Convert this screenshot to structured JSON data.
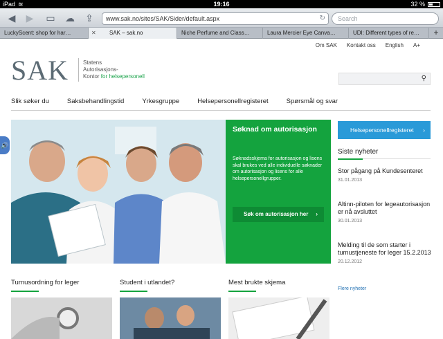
{
  "status": {
    "time": "19:16",
    "battery": "32 %",
    "battery_level": 0.32
  },
  "browser": {
    "url": "www.sak.no/sites/SAK/Sider/default.aspx",
    "search_placeholder": "Search",
    "tabs": [
      {
        "label": "LuckyScent: shop for har…"
      },
      {
        "label": "SAK – sak.no",
        "active": true
      },
      {
        "label": "Niche Perfume and Class…"
      },
      {
        "label": "Laura Mercier Eye Canva…"
      },
      {
        "label": "UDI: Different types of re…"
      }
    ],
    "icons": {
      "back": "back-arrow-icon",
      "forward": "forward-arrow-icon",
      "bookmarks": "book-icon",
      "cloud": "icloud-icon",
      "share": "share-icon",
      "reload": "reload-icon",
      "close": "close-icon",
      "add": "plus-icon"
    }
  },
  "site": {
    "toplinks": [
      "Om SAK",
      "Kontakt oss",
      "English",
      "A+"
    ],
    "logo": {
      "mark": "SAK",
      "line1": "Statens",
      "line2": "Autorisasjons-",
      "line3_prefix": "Kontor ",
      "line3_green": "for helsepersonell"
    },
    "nav": [
      "Slik søker du",
      "Saksbehandlingstid",
      "Yrkesgruppe",
      "Helsepersonellregisteret",
      "Spørsmål og svar"
    ],
    "hero": {
      "title": "Søknad om autorisasjon",
      "body": "Søknadsskjema for autorisasjon og lisens skal brukes ved alle individuelle søknader om autorisasjon og lisens for alle helsepersonellgrupper.",
      "button": "Søk om autorisasjon her",
      "arrow": "›"
    },
    "right": {
      "button": "Helsepersonellregisteret",
      "arrow": "›",
      "news_title": "Siste nyheter",
      "news": [
        {
          "title": "Stor pågang på Kundesenteret",
          "date": "31.01.2013"
        },
        {
          "title": "Altinn-piloten for legeautorisasjon er nå avsluttet",
          "date": "30.01.2013"
        },
        {
          "title": "Melding til de som starter i turnustjeneste for leger 15.2.2013",
          "date": "20.12.2012"
        }
      ],
      "more": "Flere nyheter"
    },
    "features": [
      {
        "title": "Turnusordning for leger"
      },
      {
        "title": "Student i utlandet?"
      },
      {
        "title": "Mest brukte skjema"
      }
    ]
  },
  "colors": {
    "green": "#14a33e",
    "blue": "#2a9ad8",
    "logo_grey": "#5c6b74"
  }
}
